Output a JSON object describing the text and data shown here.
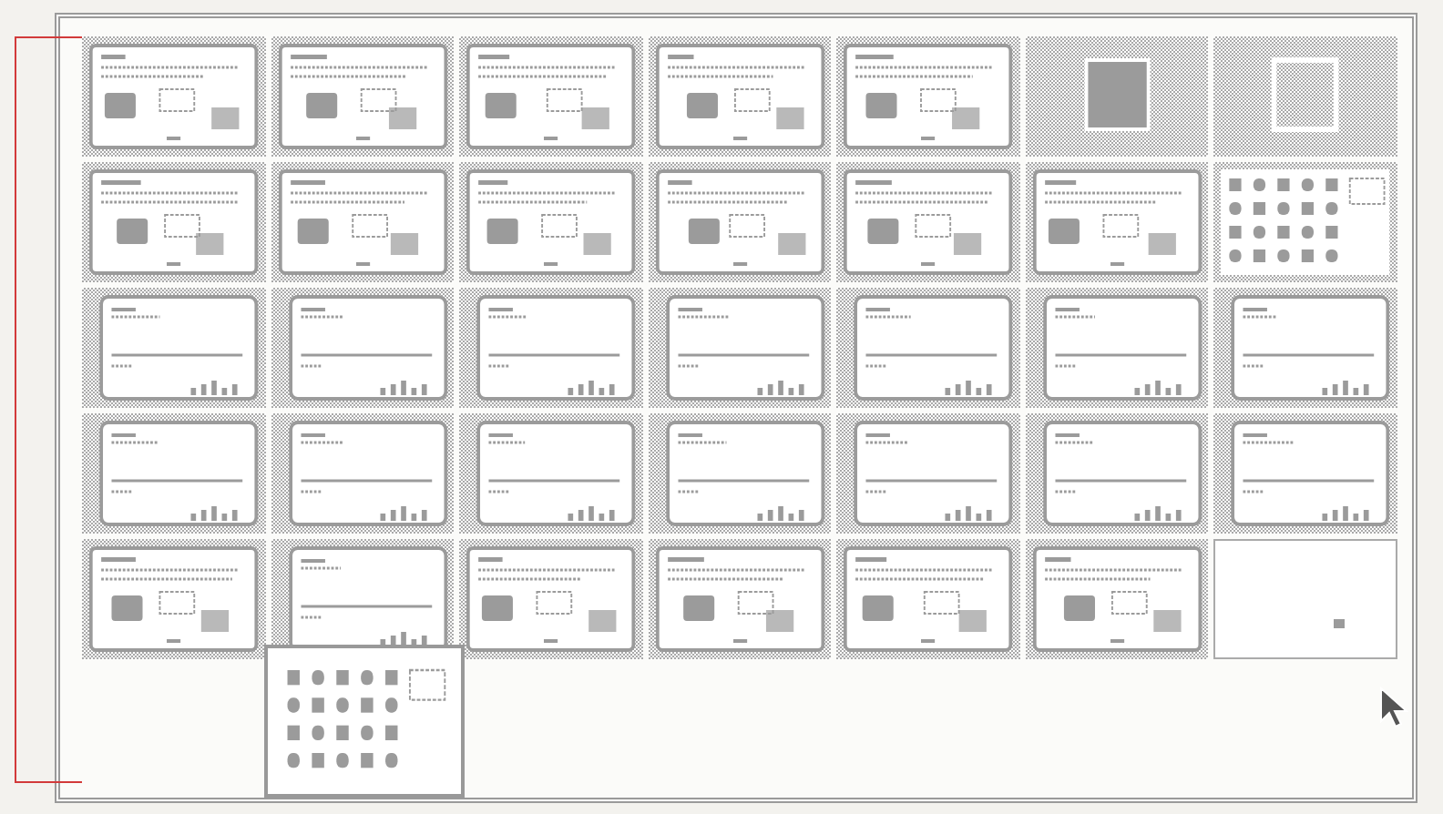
{
  "sorter": {
    "slides": [
      {
        "kind": "diagram"
      },
      {
        "kind": "diagram"
      },
      {
        "kind": "diagram"
      },
      {
        "kind": "diagram"
      },
      {
        "kind": "diagram"
      },
      {
        "kind": "filled"
      },
      {
        "kind": "outline"
      },
      {
        "kind": "diagram"
      },
      {
        "kind": "diagram"
      },
      {
        "kind": "diagram"
      },
      {
        "kind": "diagram"
      },
      {
        "kind": "diagram"
      },
      {
        "kind": "diagram"
      },
      {
        "kind": "icons"
      },
      {
        "kind": "form"
      },
      {
        "kind": "form"
      },
      {
        "kind": "form"
      },
      {
        "kind": "form"
      },
      {
        "kind": "form"
      },
      {
        "kind": "form"
      },
      {
        "kind": "form"
      },
      {
        "kind": "form"
      },
      {
        "kind": "form"
      },
      {
        "kind": "form"
      },
      {
        "kind": "form"
      },
      {
        "kind": "form"
      },
      {
        "kind": "form"
      },
      {
        "kind": "form"
      },
      {
        "kind": "diagram"
      },
      {
        "kind": "form"
      },
      {
        "kind": "diagram"
      },
      {
        "kind": "diagram"
      },
      {
        "kind": "diagram"
      },
      {
        "kind": "diagram"
      },
      {
        "kind": "empty"
      }
    ]
  },
  "preview": {
    "kind": "icons"
  }
}
